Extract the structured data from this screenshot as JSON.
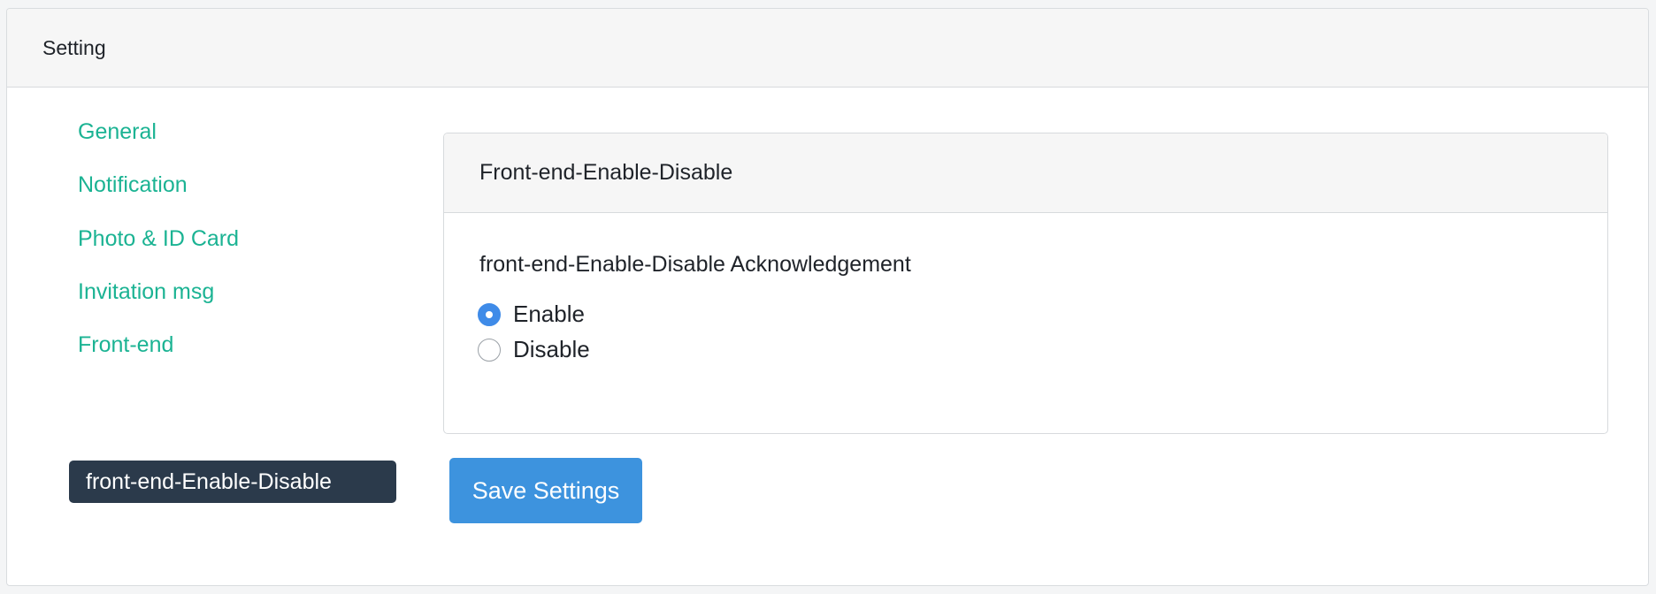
{
  "card": {
    "title": "Setting"
  },
  "nav": {
    "items": [
      {
        "label": "General",
        "active": false
      },
      {
        "label": "Notification",
        "active": false
      },
      {
        "label": "Photo & ID Card",
        "active": false
      },
      {
        "label": "Invitation msg",
        "active": false
      },
      {
        "label": "Front-end",
        "active": false
      },
      {
        "label": "front-end-Enable-Disable",
        "active": true
      }
    ]
  },
  "panel": {
    "title": "Front-end-Enable-Disable",
    "field_label": "front-end-Enable-Disable Acknowledgement",
    "options": [
      {
        "label": "Enable",
        "checked": true
      },
      {
        "label": "Disable",
        "checked": false
      }
    ]
  },
  "actions": {
    "save_label": "Save Settings"
  },
  "colors": {
    "accent_link": "#1bb393",
    "active_nav_bg": "#2b3a4b",
    "primary_button": "#3d93de",
    "radio_checked": "#3f8be8"
  }
}
